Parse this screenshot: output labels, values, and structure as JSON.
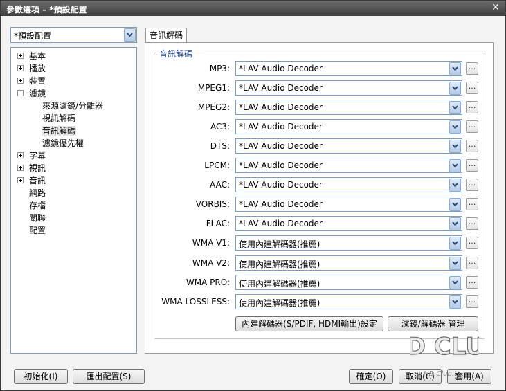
{
  "window": {
    "title": "參數選項 – *預設配置"
  },
  "profile": {
    "selected": "*預設配置"
  },
  "tree": {
    "items": [
      {
        "label": "基本",
        "expander": "plus"
      },
      {
        "label": "播放",
        "expander": "plus"
      },
      {
        "label": "裝置",
        "expander": "plus"
      },
      {
        "label": "濾鏡",
        "expander": "minus"
      },
      {
        "label": "來源濾鏡/分離器",
        "expander": "none"
      },
      {
        "label": "視訊解碼",
        "expander": "none"
      },
      {
        "label": "音訊解碼",
        "expander": "none",
        "selected": true
      },
      {
        "label": "濾鏡優先權",
        "expander": "none"
      },
      {
        "label": "字幕",
        "expander": "plus"
      },
      {
        "label": "視訊",
        "expander": "plus"
      },
      {
        "label": "音訊",
        "expander": "plus"
      },
      {
        "label": "網路",
        "expander": "none"
      },
      {
        "label": "存檔",
        "expander": "none"
      },
      {
        "label": "關聯",
        "expander": "none"
      },
      {
        "label": "配置",
        "expander": "none"
      }
    ]
  },
  "tab": {
    "label": "音訊解碼"
  },
  "group": {
    "title": "音訊解碼"
  },
  "decoders": [
    {
      "label": "MP3:",
      "value": "*LAV Audio Decoder"
    },
    {
      "label": "MPEG1:",
      "value": "*LAV Audio Decoder"
    },
    {
      "label": "MPEG2:",
      "value": "*LAV Audio Decoder"
    },
    {
      "label": "AC3:",
      "value": "*LAV Audio Decoder"
    },
    {
      "label": "DTS:",
      "value": "*LAV Audio Decoder"
    },
    {
      "label": "LPCM:",
      "value": "*LAV Audio Decoder"
    },
    {
      "label": "AAC:",
      "value": "*LAV Audio Decoder"
    },
    {
      "label": "VORBIS:",
      "value": "*LAV Audio Decoder"
    },
    {
      "label": "FLAC:",
      "value": "*LAV Audio Decoder"
    },
    {
      "label": "WMA V1:",
      "value": "使用內建解碼器(推薦)"
    },
    {
      "label": "WMA V2:",
      "value": "使用內建解碼器(推薦)"
    },
    {
      "label": "WMA PRO:",
      "value": "使用內建解碼器(推薦)"
    },
    {
      "label": "WMA LOSSLESS:",
      "value": "使用內建解碼器(推薦)"
    }
  ],
  "dots_label": "...",
  "buttons": {
    "builtin_settings": "內建解碼器(S/PDIF, HDMI輸出)設定",
    "filter_manager": "濾鏡/解碼器 管理",
    "reset": "初始化(I)",
    "export": "匯出配置(S)",
    "ok": "確定(O)",
    "cancel": "取消(C)",
    "apply": "套用(A)"
  },
  "watermark": {
    "brand": "HD CLUB",
    "url": "HD.Club.tw"
  }
}
